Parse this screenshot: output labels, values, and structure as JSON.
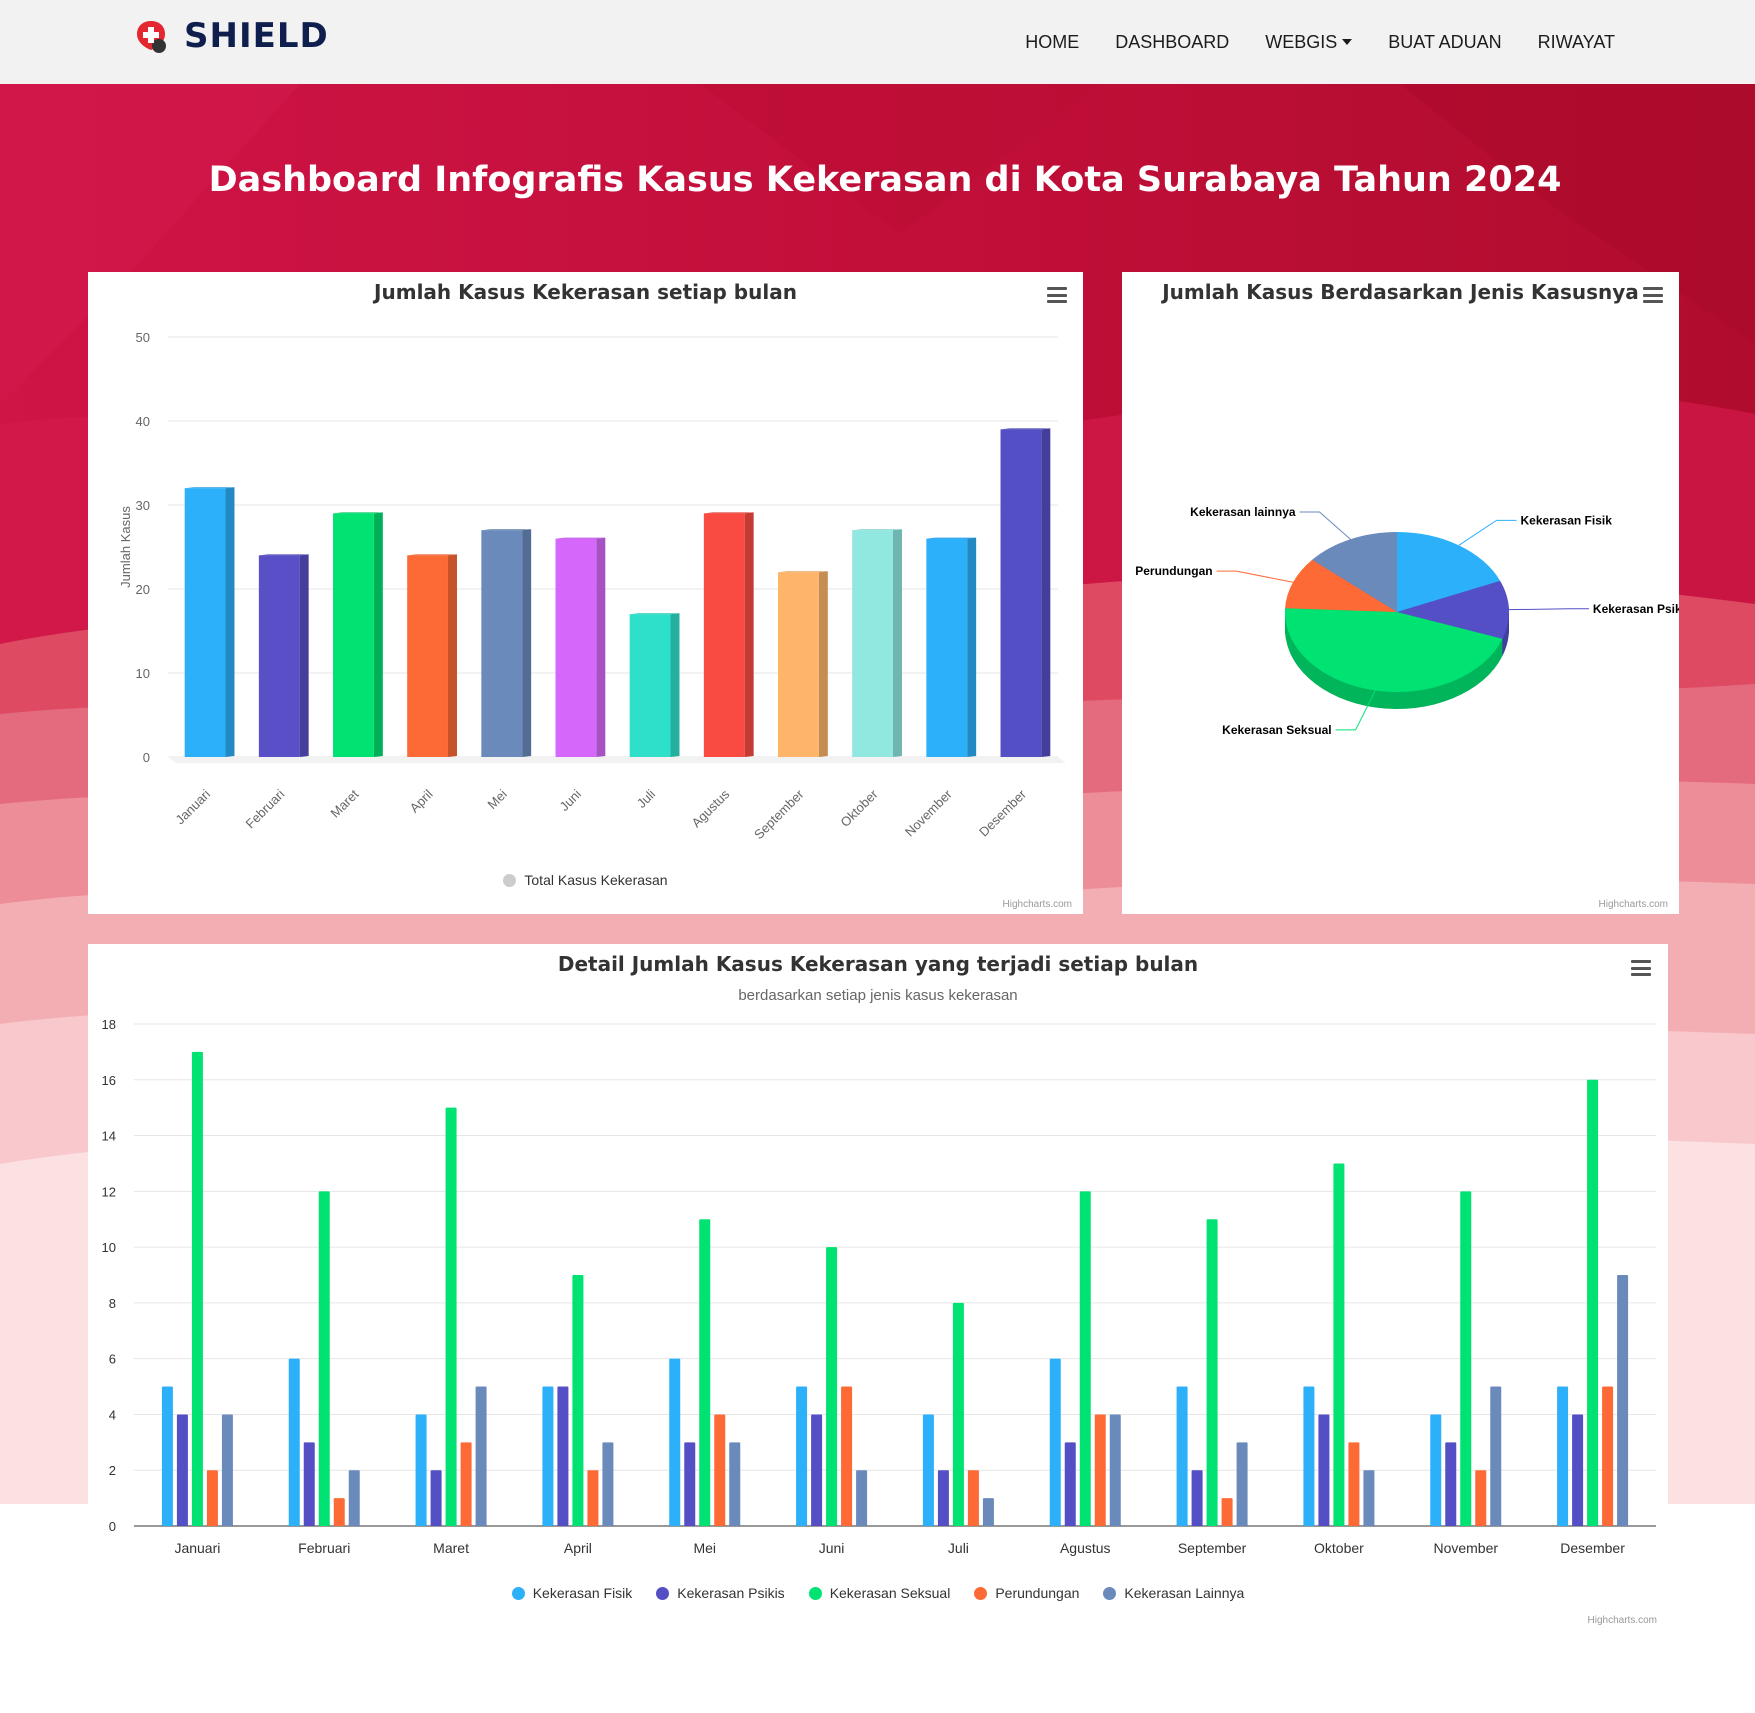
{
  "navbar": {
    "brand": "SHIELD",
    "items": [
      {
        "label": "HOME"
      },
      {
        "label": "DASHBOARD"
      },
      {
        "label": "WEBGIS"
      },
      {
        "label": "BUAT ADUAN"
      },
      {
        "label": "RIWAYAT"
      }
    ]
  },
  "page": {
    "title": "Dashboard Infografis Kasus Kekerasan di Kota Surabaya Tahun 2024"
  },
  "colors": {
    "brand_red": "#c8113b",
    "series": [
      "#2cb0fa",
      "#5950c8",
      "#00e272",
      "#fe6a35",
      "#6b8abc",
      "#d568fb",
      "#2ee0ca",
      "#fa4b42",
      "#feb56a",
      "#91e8e1",
      "#2cb0fa",
      "#544fc5"
    ]
  },
  "charts": {
    "monthly": {
      "title": "Jumlah Kasus Kekerasan setiap bulan",
      "legend": "Total Kasus Kekerasan",
      "credits": "Highcharts.com"
    },
    "pie": {
      "title": "Jumlah Kasus Berdasarkan Jenis Kasusnya",
      "credits": "Highcharts.com"
    },
    "detail": {
      "title": "Detail Jumlah Kasus Kekerasan yang terjadi setiap bulan",
      "subtitle": "berdasarkan setiap jenis kasus kekerasan",
      "credits": "Highcharts.com"
    }
  },
  "chart_data": [
    {
      "type": "bar",
      "title": "Jumlah Kasus Kekerasan setiap bulan",
      "categories": [
        "Januari",
        "Februari",
        "Maret",
        "April",
        "Mei",
        "Juni",
        "Juli",
        "Agustus",
        "September",
        "Oktober",
        "November",
        "Desember"
      ],
      "series": [
        {
          "name": "Total Kasus Kekerasan",
          "values": [
            32,
            24,
            29,
            24,
            27,
            26,
            17,
            29,
            22,
            27,
            26,
            39
          ]
        }
      ],
      "xlabel": "",
      "ylabel": "Jumlah Kasus",
      "ylim": [
        0,
        50
      ],
      "yticks": [
        0,
        10,
        20,
        30,
        40,
        50
      ],
      "legend": "bottom-center",
      "grid": true
    },
    {
      "type": "pie",
      "title": "Jumlah Kasus Berdasarkan Jenis Kasusnya",
      "slices": [
        {
          "label": "Kekerasan Fisik",
          "value": 60,
          "color": "#2cb0fa"
        },
        {
          "label": "Kekerasan Psikis",
          "value": 38,
          "color": "#544fc5"
        },
        {
          "label": "Kekerasan Seksual",
          "value": 146,
          "color": "#00e272"
        },
        {
          "label": "Perundungan",
          "value": 34,
          "color": "#fe6a35"
        },
        {
          "label": "Kekerasan lainnya",
          "value": 44,
          "color": "#6b8abc"
        }
      ]
    },
    {
      "type": "bar",
      "title": "Detail Jumlah Kasus Kekerasan yang terjadi setiap bulan",
      "subtitle": "berdasarkan setiap jenis kasus kekerasan",
      "categories": [
        "Januari",
        "Februari",
        "Maret",
        "April",
        "Mei",
        "Juni",
        "Juli",
        "Agustus",
        "September",
        "Oktober",
        "November",
        "Desember"
      ],
      "series": [
        {
          "name": "Kekerasan Fisik",
          "color": "#2cb0fa",
          "values": [
            5,
            6,
            4,
            5,
            6,
            5,
            4,
            6,
            5,
            5,
            4,
            5
          ]
        },
        {
          "name": "Kekerasan Psikis",
          "color": "#544fc5",
          "values": [
            4,
            3,
            2,
            5,
            3,
            4,
            2,
            3,
            2,
            4,
            3,
            4
          ]
        },
        {
          "name": "Kekerasan Seksual",
          "color": "#00e272",
          "values": [
            17,
            12,
            15,
            9,
            11,
            10,
            8,
            12,
            11,
            13,
            12,
            16
          ]
        },
        {
          "name": "Perundungan",
          "color": "#fe6a35",
          "values": [
            2,
            1,
            3,
            2,
            4,
            5,
            2,
            4,
            1,
            3,
            2,
            5
          ]
        },
        {
          "name": "Kekerasan Lainnya",
          "color": "#6b8abc",
          "values": [
            4,
            2,
            5,
            3,
            3,
            2,
            1,
            4,
            3,
            2,
            5,
            9
          ]
        }
      ],
      "ylim": [
        0,
        18
      ],
      "yticks": [
        0,
        2,
        4,
        6,
        8,
        10,
        12,
        14,
        16,
        18
      ],
      "legend": "bottom-center",
      "grid": true
    }
  ]
}
